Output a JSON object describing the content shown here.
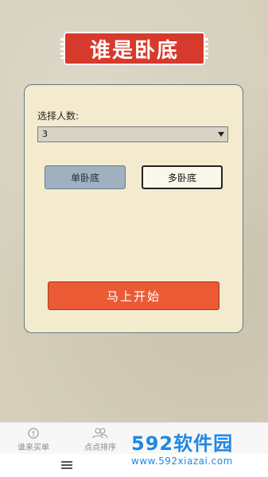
{
  "app": {
    "logo_text": "谁是卧底"
  },
  "setup": {
    "count_label": "选择人数:",
    "count_value": "3",
    "mode_single": "单卧底",
    "mode_multi": "多卧底",
    "start_label": "马上开始"
  },
  "bottom_nav": {
    "items": [
      {
        "label": "谁来买单",
        "icon": "info-icon"
      },
      {
        "label": "点点排序",
        "icon": "users-icon"
      }
    ]
  },
  "watermark": {
    "brand": "592软件园",
    "url": "www.592xiazai.com"
  },
  "colors": {
    "accent": "#ec5a35",
    "logo_red": "#d63a2c",
    "card_bg": "#f4ebcf",
    "watermark_blue": "#1e88e5"
  }
}
